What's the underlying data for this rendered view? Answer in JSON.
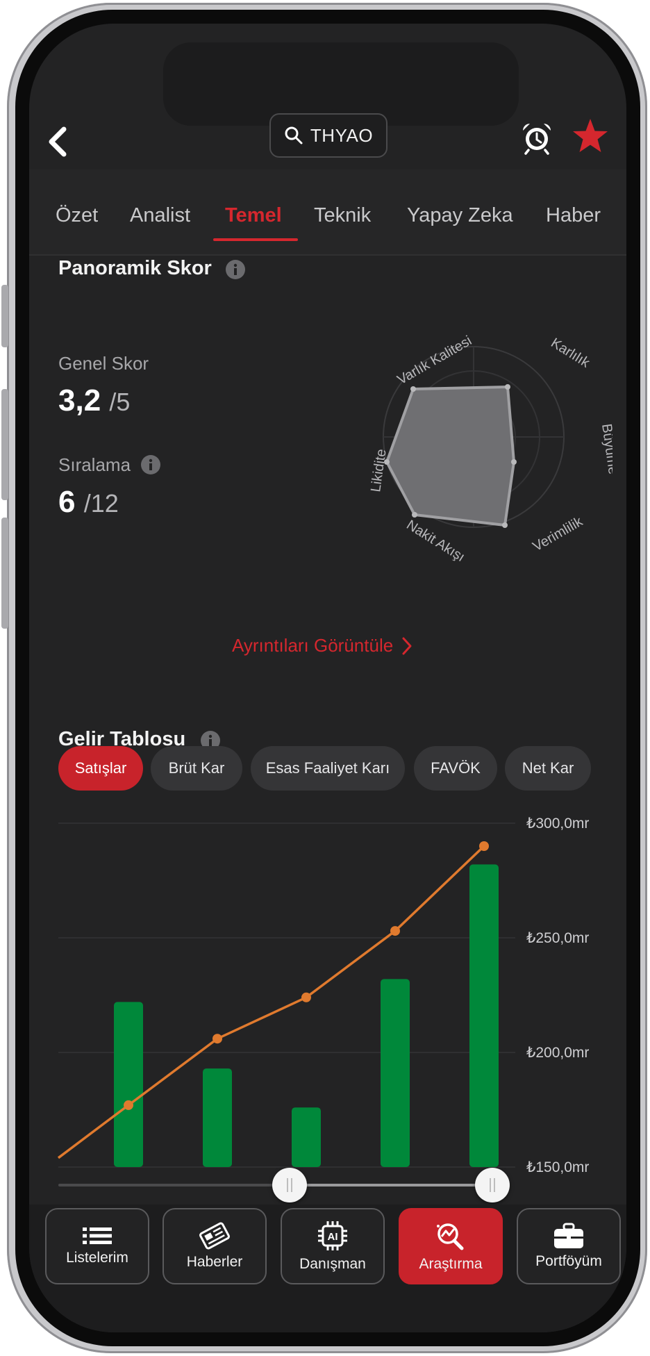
{
  "header": {
    "search_text": "THYAO"
  },
  "tabs": [
    {
      "label": "Özet"
    },
    {
      "label": "Analist"
    },
    {
      "label": "Temel"
    },
    {
      "label": "Teknik"
    },
    {
      "label": "Yapay Zeka"
    },
    {
      "label": "Haber"
    }
  ],
  "active_tab": "Temel",
  "score": {
    "title": "Panoramik Skor",
    "general_label": "Genel Skor",
    "general_value": "3,2",
    "general_max": "/5",
    "rank_label": "Sıralama",
    "rank_value": "6",
    "rank_max": "/12",
    "details_link": "Ayrıntıları Görüntüle",
    "radar_axes": [
      "Karlılık",
      "Büyüme",
      "Verimlilik",
      "Nakit Akışı",
      "Likidite",
      "Varlık Kalitesi"
    ]
  },
  "income": {
    "title": "Gelir Tablosu",
    "chips": [
      {
        "label": "Satışlar",
        "active": true
      },
      {
        "label": "Brüt Kar",
        "active": false
      },
      {
        "label": "Esas Faaliyet Karı",
        "active": false
      },
      {
        "label": "FAVÖK",
        "active": false
      },
      {
        "label": "Net Kar",
        "active": false
      }
    ],
    "y_labels": [
      "₺300,0mr",
      "₺250,0mr",
      "₺200,0mr",
      "₺150,0mr"
    ]
  },
  "chart_data": {
    "type": "bar",
    "ylim": [
      150,
      300
    ],
    "yticks": [
      150,
      200,
      250,
      300
    ],
    "series": [
      {
        "type": "bar",
        "color": "#00883a",
        "values": [
          222,
          193,
          176,
          232,
          282
        ]
      },
      {
        "type": "line",
        "color": "#e07a2e",
        "values": [
          177,
          206,
          224,
          253,
          290
        ]
      }
    ],
    "line_start_value": 154
  },
  "nav": [
    {
      "label": "Listelerim",
      "icon": "list-icon",
      "active": false
    },
    {
      "label": "Haberler",
      "icon": "newspaper-icon",
      "active": false
    },
    {
      "label": "Danışman",
      "icon": "ai-chip-icon",
      "active": false
    },
    {
      "label": "Araştırma",
      "icon": "research-icon",
      "active": true
    },
    {
      "label": "Portföyüm",
      "icon": "briefcase-icon",
      "active": false
    }
  ],
  "colors": {
    "accent": "#d5272e",
    "bar": "#00883a",
    "line": "#e07a2e"
  }
}
